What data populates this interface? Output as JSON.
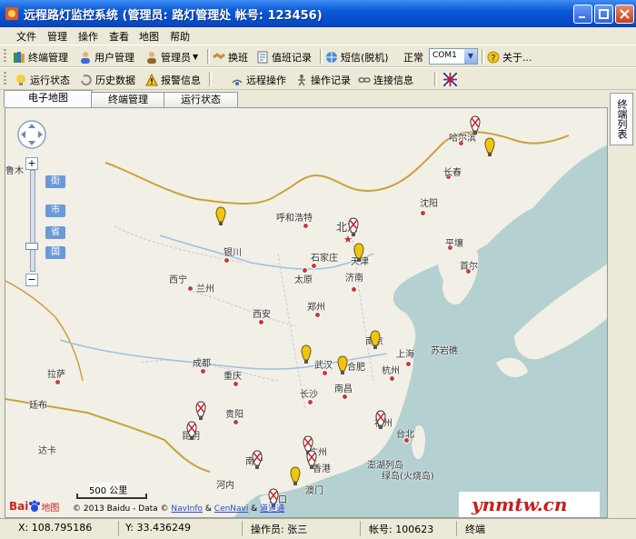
{
  "window": {
    "title": "远程路灯监控系统 (管理员: 路灯管理处  帐号: 123456)"
  },
  "menu": [
    "文件",
    "管理",
    "操作",
    "查看",
    "地图",
    "帮助"
  ],
  "toolbar1": {
    "terminal_mgmt": "终端管理",
    "user_mgmt": "用户管理",
    "admin": "管理员",
    "shift": "换班",
    "duty_log": "值班记录",
    "sms": "短信(脱机)",
    "status": "正常",
    "com_port": "COM1",
    "about": "关于..."
  },
  "toolbar2": {
    "run_status": "运行状态",
    "history": "历史数据",
    "alarm": "报警信息",
    "remote_op": "远程操作",
    "op_log": "操作记录",
    "conn_info": "连接信息"
  },
  "tabs": [
    "电子地图",
    "终端管理",
    "运行状态"
  ],
  "side_tab": "终端列表",
  "map": {
    "level_buttons": [
      "街",
      "市",
      "省",
      "国"
    ],
    "scale": "500 公里",
    "copyright_prefix": "© 2013 Baidu - Data © ",
    "copyright_navinfo": "NavInfo",
    "copyright_amp": " & ",
    "copyright_cennavi": "CenNavi",
    "copyright_amp2": " & ",
    "copyright_road": "道道通",
    "logo_bai": "Bai",
    "logo_map": "地图",
    "cities": [
      {
        "name": "哈尔滨"
      },
      {
        "name": "长春"
      },
      {
        "name": "沈阳"
      },
      {
        "name": "平壤"
      },
      {
        "name": "首尔"
      },
      {
        "name": "北京"
      },
      {
        "name": "天津"
      },
      {
        "name": "呼和浩特"
      },
      {
        "name": "石家庄"
      },
      {
        "name": "太原"
      },
      {
        "name": "济南"
      },
      {
        "name": "银川"
      },
      {
        "name": "西宁"
      },
      {
        "name": "兰州"
      },
      {
        "name": "郑州"
      },
      {
        "name": "西安"
      },
      {
        "name": "南京"
      },
      {
        "name": "上海"
      },
      {
        "name": "合肥"
      },
      {
        "name": "武汉"
      },
      {
        "name": "杭州"
      },
      {
        "name": "成都"
      },
      {
        "name": "重庆"
      },
      {
        "name": "长沙"
      },
      {
        "name": "南昌"
      },
      {
        "name": "贵阳"
      },
      {
        "name": "昆明"
      },
      {
        "name": "福州"
      },
      {
        "name": "台北"
      },
      {
        "name": "南宁"
      },
      {
        "name": "广州"
      },
      {
        "name": "香港"
      },
      {
        "name": "澳门"
      },
      {
        "name": "拉萨"
      },
      {
        "name": "鲁木"
      },
      {
        "name": "达卡"
      },
      {
        "name": "廷布"
      },
      {
        "name": "苏岩礁"
      },
      {
        "name": "澎湖列岛"
      },
      {
        "name": "绿岛(火烧岛)"
      },
      {
        "name": "河内"
      },
      {
        "name": "海口"
      }
    ]
  },
  "statusbar": {
    "x": "X: 108.795186",
    "y": "Y: 33.436249",
    "operator": "操作员: 张三",
    "account": "帐号: 100623",
    "terminal": "终端"
  },
  "watermark": "ynmtw.cn",
  "colors": {
    "titlebar": "#0a5ad8",
    "map_sea": "#b5d0d0",
    "map_land": "#f2efe6",
    "pin_yellow": "#f2c412",
    "pin_red": "#d02020"
  }
}
